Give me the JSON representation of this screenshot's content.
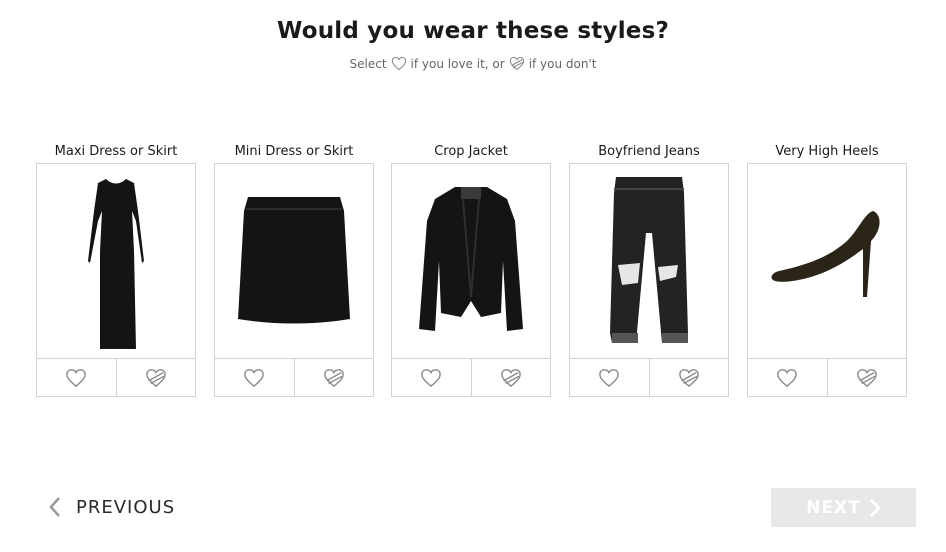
{
  "header": {
    "title": "Would you wear these styles?",
    "subtitle_select": "Select",
    "subtitle_love": "if you love it, or",
    "subtitle_dont": "if you don't"
  },
  "items": [
    {
      "label": "Maxi Dress or Skirt",
      "image_icon": "maxi-dress-icon"
    },
    {
      "label": "Mini Dress or Skirt",
      "image_icon": "mini-skirt-icon"
    },
    {
      "label": "Crop Jacket",
      "image_icon": "crop-jacket-icon"
    },
    {
      "label": "Boyfriend Jeans",
      "image_icon": "boyfriend-jeans-icon"
    },
    {
      "label": "Very High Heels",
      "image_icon": "high-heels-icon"
    }
  ],
  "actions": {
    "love_icon": "heart-icon",
    "dislike_icon": "crossed-heart-icon"
  },
  "navigation": {
    "previous_label": "PREVIOUS",
    "next_label": "NEXT"
  },
  "colors": {
    "border": "#d3d3d3",
    "next_bg": "#e8e8e8",
    "icon": "#888888",
    "text": "#1a1a1a"
  }
}
